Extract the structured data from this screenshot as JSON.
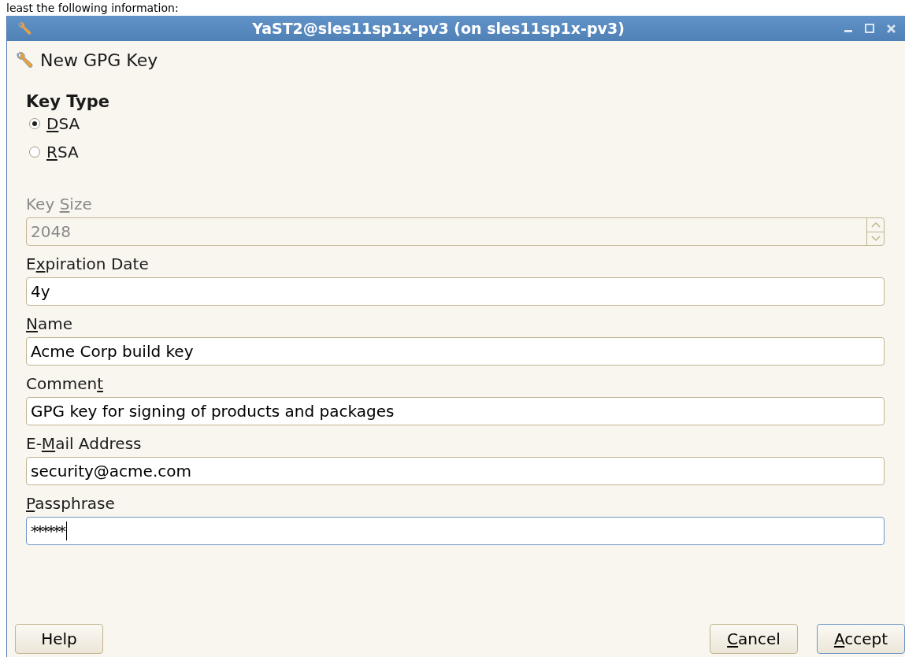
{
  "background_text": "least the following information:",
  "window": {
    "title": "YaST2@sles11sp1x-pv3 (on sles11sp1x-pv3)"
  },
  "dialog": {
    "heading": "New GPG Key"
  },
  "key_type": {
    "label": "Key Type",
    "options": [
      {
        "label": {
          "mnemonic": "D",
          "after": "SA"
        },
        "selected": true
      },
      {
        "label": {
          "mnemonic": "R",
          "after": "SA"
        },
        "selected": false
      }
    ]
  },
  "fields": [
    {
      "kind": "spin",
      "label": {
        "before": "Key ",
        "mnemonic": "S",
        "after": "ize"
      },
      "value": "2048",
      "disabled": true,
      "focused": false
    },
    {
      "kind": "text",
      "label": {
        "before": "E",
        "mnemonic": "x",
        "after": "piration Date"
      },
      "value": "4y",
      "disabled": false,
      "focused": false
    },
    {
      "kind": "text",
      "label": {
        "mnemonic": "N",
        "after": "ame"
      },
      "value": "Acme Corp build key",
      "disabled": false,
      "focused": false
    },
    {
      "kind": "text",
      "label": {
        "before": "Commen",
        "mnemonic": "t"
      },
      "value": "GPG key for signing of products and packages",
      "disabled": false,
      "focused": false
    },
    {
      "kind": "text",
      "label": {
        "before": "E-",
        "mnemonic": "M",
        "after": "ail Address"
      },
      "value": "security@acme.com",
      "disabled": false,
      "focused": false
    },
    {
      "kind": "password",
      "label": {
        "mnemonic": "P",
        "after": "assphrase"
      },
      "value": "******",
      "disabled": false,
      "focused": true
    }
  ],
  "buttons": {
    "help": {
      "label": {
        "before": "Help"
      }
    },
    "cancel": {
      "label": {
        "mnemonic": "C",
        "after": "ancel"
      }
    },
    "accept": {
      "label": {
        "mnemonic": "A",
        "after": "ccept"
      },
      "focused": true
    }
  }
}
